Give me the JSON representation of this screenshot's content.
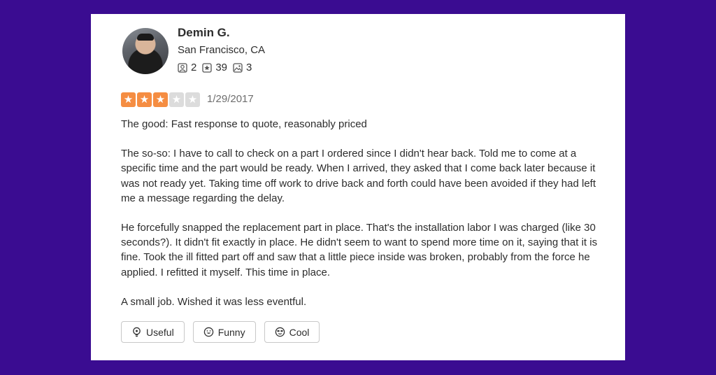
{
  "review": {
    "user": {
      "name": "Demin G.",
      "location": "San Francisco, CA",
      "friends": "2",
      "reviews": "39",
      "photos": "3"
    },
    "rating": 3,
    "rating_max": 5,
    "date": "1/29/2017",
    "paragraphs": [
      "The good: Fast response to quote, reasonably priced",
      "The so-so: I have to call to check on a part I ordered since I didn't hear back. Told me to come at a specific time and the part would be ready. When I arrived, they asked that I come back later because it was not ready yet. Taking time off work to drive back and forth could have been avoided if they had left me a message regarding the delay.",
      "He forcefully snapped the replacement part in place. That's the installation labor I was charged (like 30 seconds?). It didn't fit exactly in place. He didn't seem to want  to spend more time on it, saying that it is fine. Took the ill fitted part off and saw that a little piece inside was broken, probably from the force he applied. I refitted it myself. This time in place.",
      "A small job. Wished it was less eventful."
    ],
    "actions": {
      "useful": "Useful",
      "funny": "Funny",
      "cool": "Cool"
    }
  },
  "colors": {
    "background": "#3a0c91",
    "star_on": "#f58d42",
    "star_off": "#dcdcdc"
  }
}
